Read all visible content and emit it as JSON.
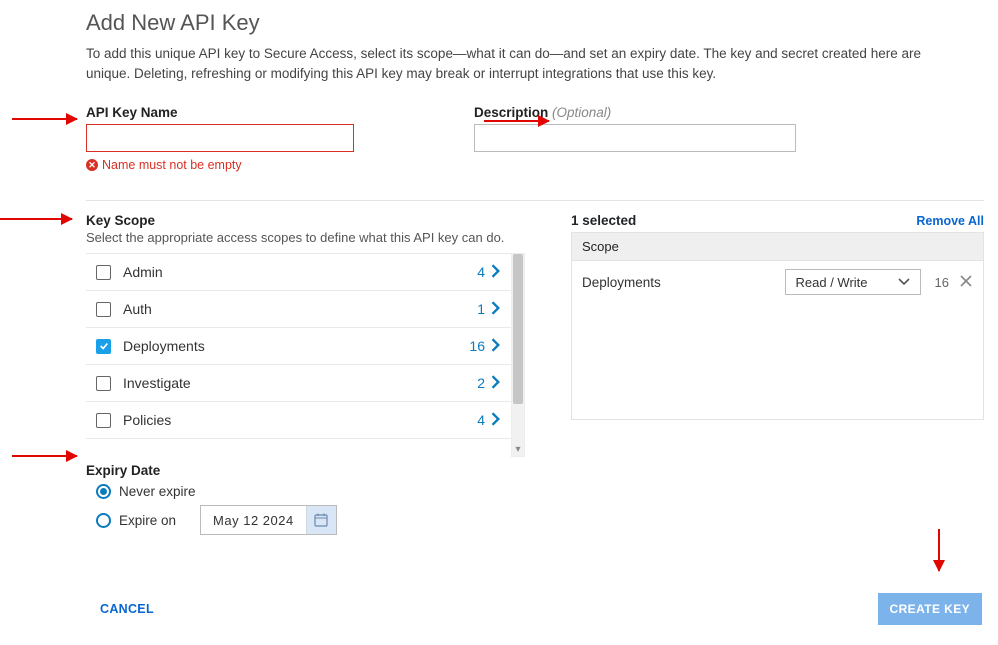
{
  "header": {
    "title": "Add New API Key",
    "intro": "To add this unique API key to Secure Access, select its scope—what it can do—and set an expiry date. The key and secret created here are unique. Deleting, refreshing or modifying this API key may break or interrupt integrations that use this key."
  },
  "fields": {
    "name_label": "API Key Name",
    "name_value": "",
    "name_error": "Name must not be empty",
    "desc_label": "Description",
    "desc_optional": "(Optional)",
    "desc_value": ""
  },
  "scope": {
    "title": "Key Scope",
    "subtitle": "Select the appropriate access scopes to define what this API key can do.",
    "items": [
      {
        "label": "Admin",
        "count": "4",
        "checked": false
      },
      {
        "label": "Auth",
        "count": "1",
        "checked": false
      },
      {
        "label": "Deployments",
        "count": "16",
        "checked": true
      },
      {
        "label": "Investigate",
        "count": "2",
        "checked": false
      },
      {
        "label": "Policies",
        "count": "4",
        "checked": false
      }
    ]
  },
  "selected": {
    "summary": "1 selected",
    "remove_all": "Remove All",
    "header": "Scope",
    "rows": [
      {
        "name": "Deployments",
        "permission": "Read / Write",
        "count": "16"
      }
    ]
  },
  "expiry": {
    "title": "Expiry Date",
    "never": "Never expire",
    "expire_on": "Expire on",
    "date": "May  12   2024",
    "selected": "never"
  },
  "footer": {
    "cancel": "CANCEL",
    "create": "CREATE KEY"
  }
}
